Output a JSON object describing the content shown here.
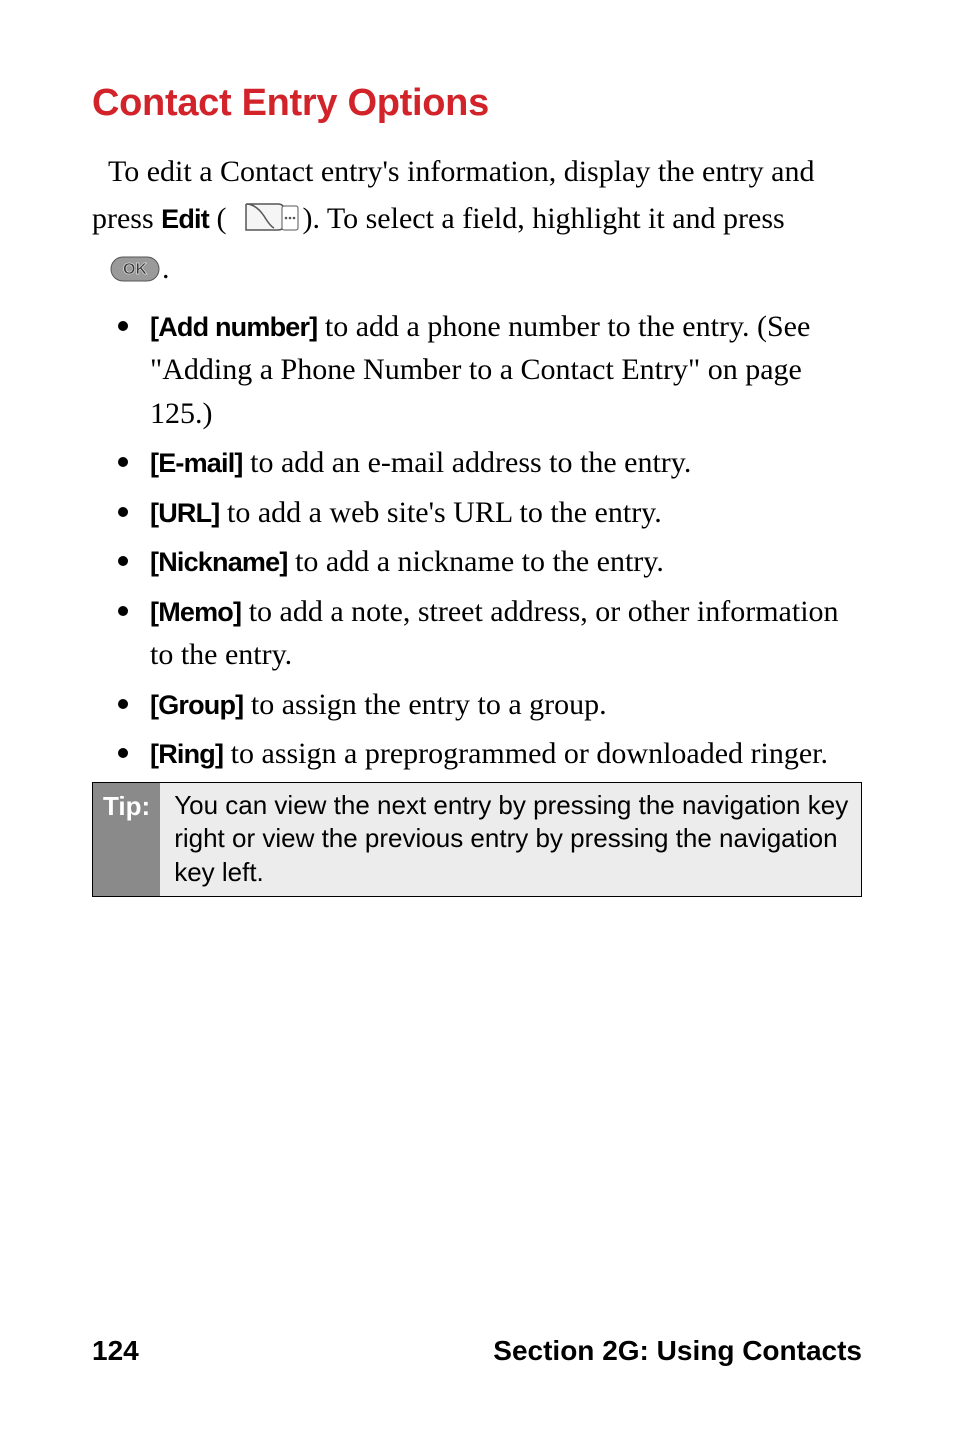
{
  "heading": "Contact Entry Options",
  "intro": {
    "part1": "To edit a Contact entry's information, display the entry and press ",
    "edit_label": "Edit",
    "part2": " (",
    "part3": "). To select a field, highlight it and press ",
    "period": "."
  },
  "bullets": [
    {
      "bold": "[Add number]",
      "rest": " to add a phone number to the entry. (See \"Adding a Phone Number to a Contact Entry\" on page 125.)"
    },
    {
      "bold": "[E-mail]",
      "rest": " to add an e-mail address to the entry."
    },
    {
      "bold": "[URL]",
      "rest": " to add a web site's URL to the entry."
    },
    {
      "bold": "[Nickname]",
      "rest": " to add a nickname to the entry."
    },
    {
      "bold": "[Memo]",
      "rest": " to add a note, street address, or other information to the entry."
    },
    {
      "bold": "[Group]",
      "rest": " to assign the entry to a group."
    },
    {
      "bold": "[Ring]",
      "rest": " to assign a preprogrammed or downloaded ringer."
    }
  ],
  "tip": {
    "label": "Tip:",
    "body": "You can view the next entry by pressing the navigation key right or view the previous entry by pressing the navigation key left."
  },
  "footer": {
    "page_number": "124",
    "section": "Section 2G: Using Contacts"
  }
}
